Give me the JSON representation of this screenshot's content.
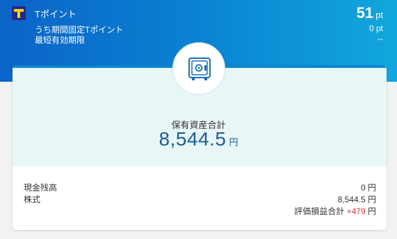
{
  "header": {
    "title": "Tポイント",
    "points_value": "51",
    "points_unit": "pt",
    "limited_label": "うち期間固定Tポイント",
    "limited_value": "0 pt",
    "expiry_label": "最短有効期限",
    "expiry_value": "--"
  },
  "assets": {
    "total_label": "保有資産合計",
    "total_value": "8,544.5",
    "total_unit": "円",
    "cash_label": "現金残高",
    "cash_value": "0",
    "stock_label": "株式",
    "stock_value": "8,544.5",
    "unit": "円",
    "gain_label": "評価損益合計",
    "gain_value": "+479"
  },
  "colors": {
    "header_gradient_start": "#0b63c7",
    "header_gradient_end": "#12a7dc",
    "card_top_bg": "#e8f6f8",
    "total_value": "#1a5e94",
    "gain_positive": "#e03535",
    "tlogo_bg": "#1e2a8c",
    "tlogo_fg": "#ffd400"
  },
  "icons": {
    "brand": "t-point-logo-icon",
    "safe": "safe-icon"
  }
}
